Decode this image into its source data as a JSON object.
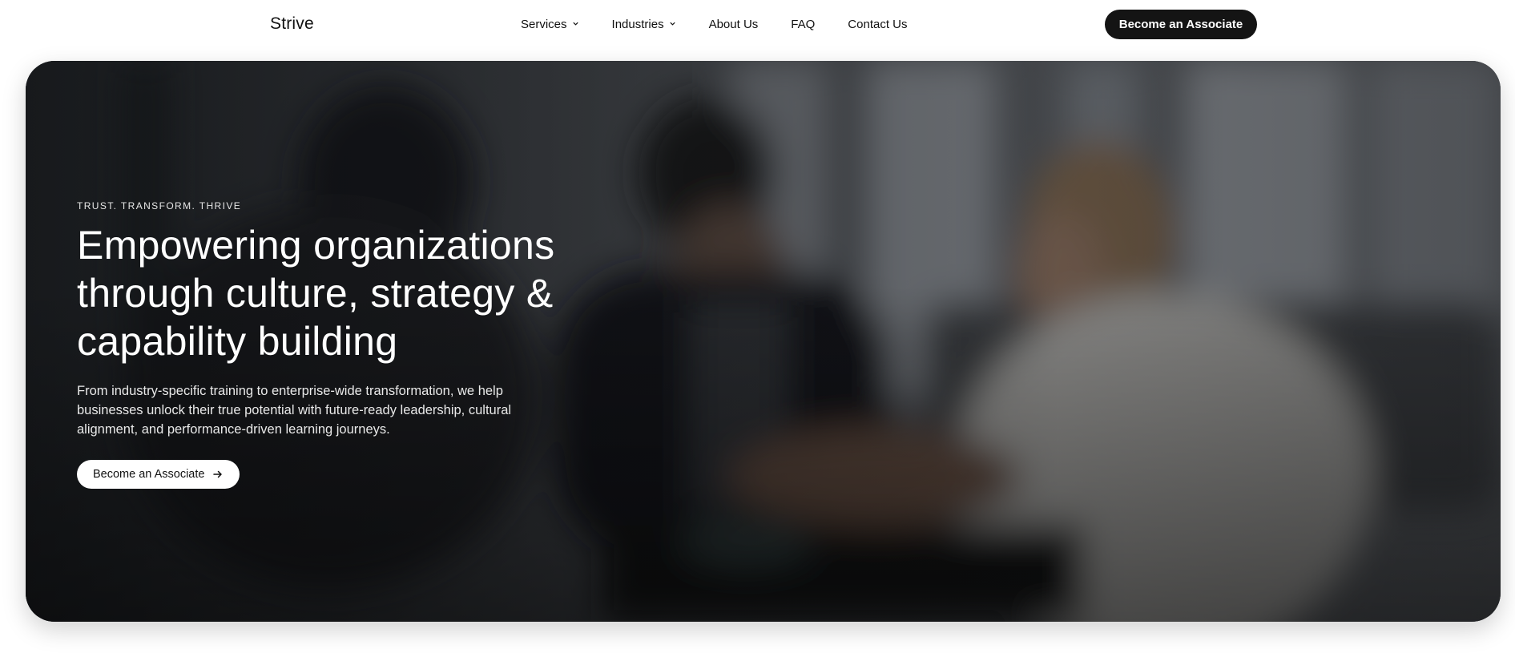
{
  "header": {
    "logo": "Strive",
    "nav": [
      {
        "label": "Services",
        "dropdown": true
      },
      {
        "label": "Industries",
        "dropdown": true
      },
      {
        "label": "About Us",
        "dropdown": false
      },
      {
        "label": "FAQ",
        "dropdown": false
      },
      {
        "label": "Contact Us",
        "dropdown": false
      }
    ],
    "cta_label": "Become an Associate"
  },
  "hero": {
    "eyebrow": "TRUST. TRANSFORM. THRIVE",
    "headline_line1": "Empowering organizations",
    "headline_line2": "through culture, strategy &",
    "headline_line3": "capability building",
    "subtext": "From industry-specific training to enterprise-wide transformation, we help businesses unlock their true potential with future-ready leadership, cultural alignment, and performance-driven learning journeys.",
    "cta_label": "Become an Associate",
    "cta_icon": "arrow-right-icon"
  },
  "colors": {
    "accent": "#141414",
    "background": "#ffffff",
    "hero_text": "#ffffff"
  }
}
